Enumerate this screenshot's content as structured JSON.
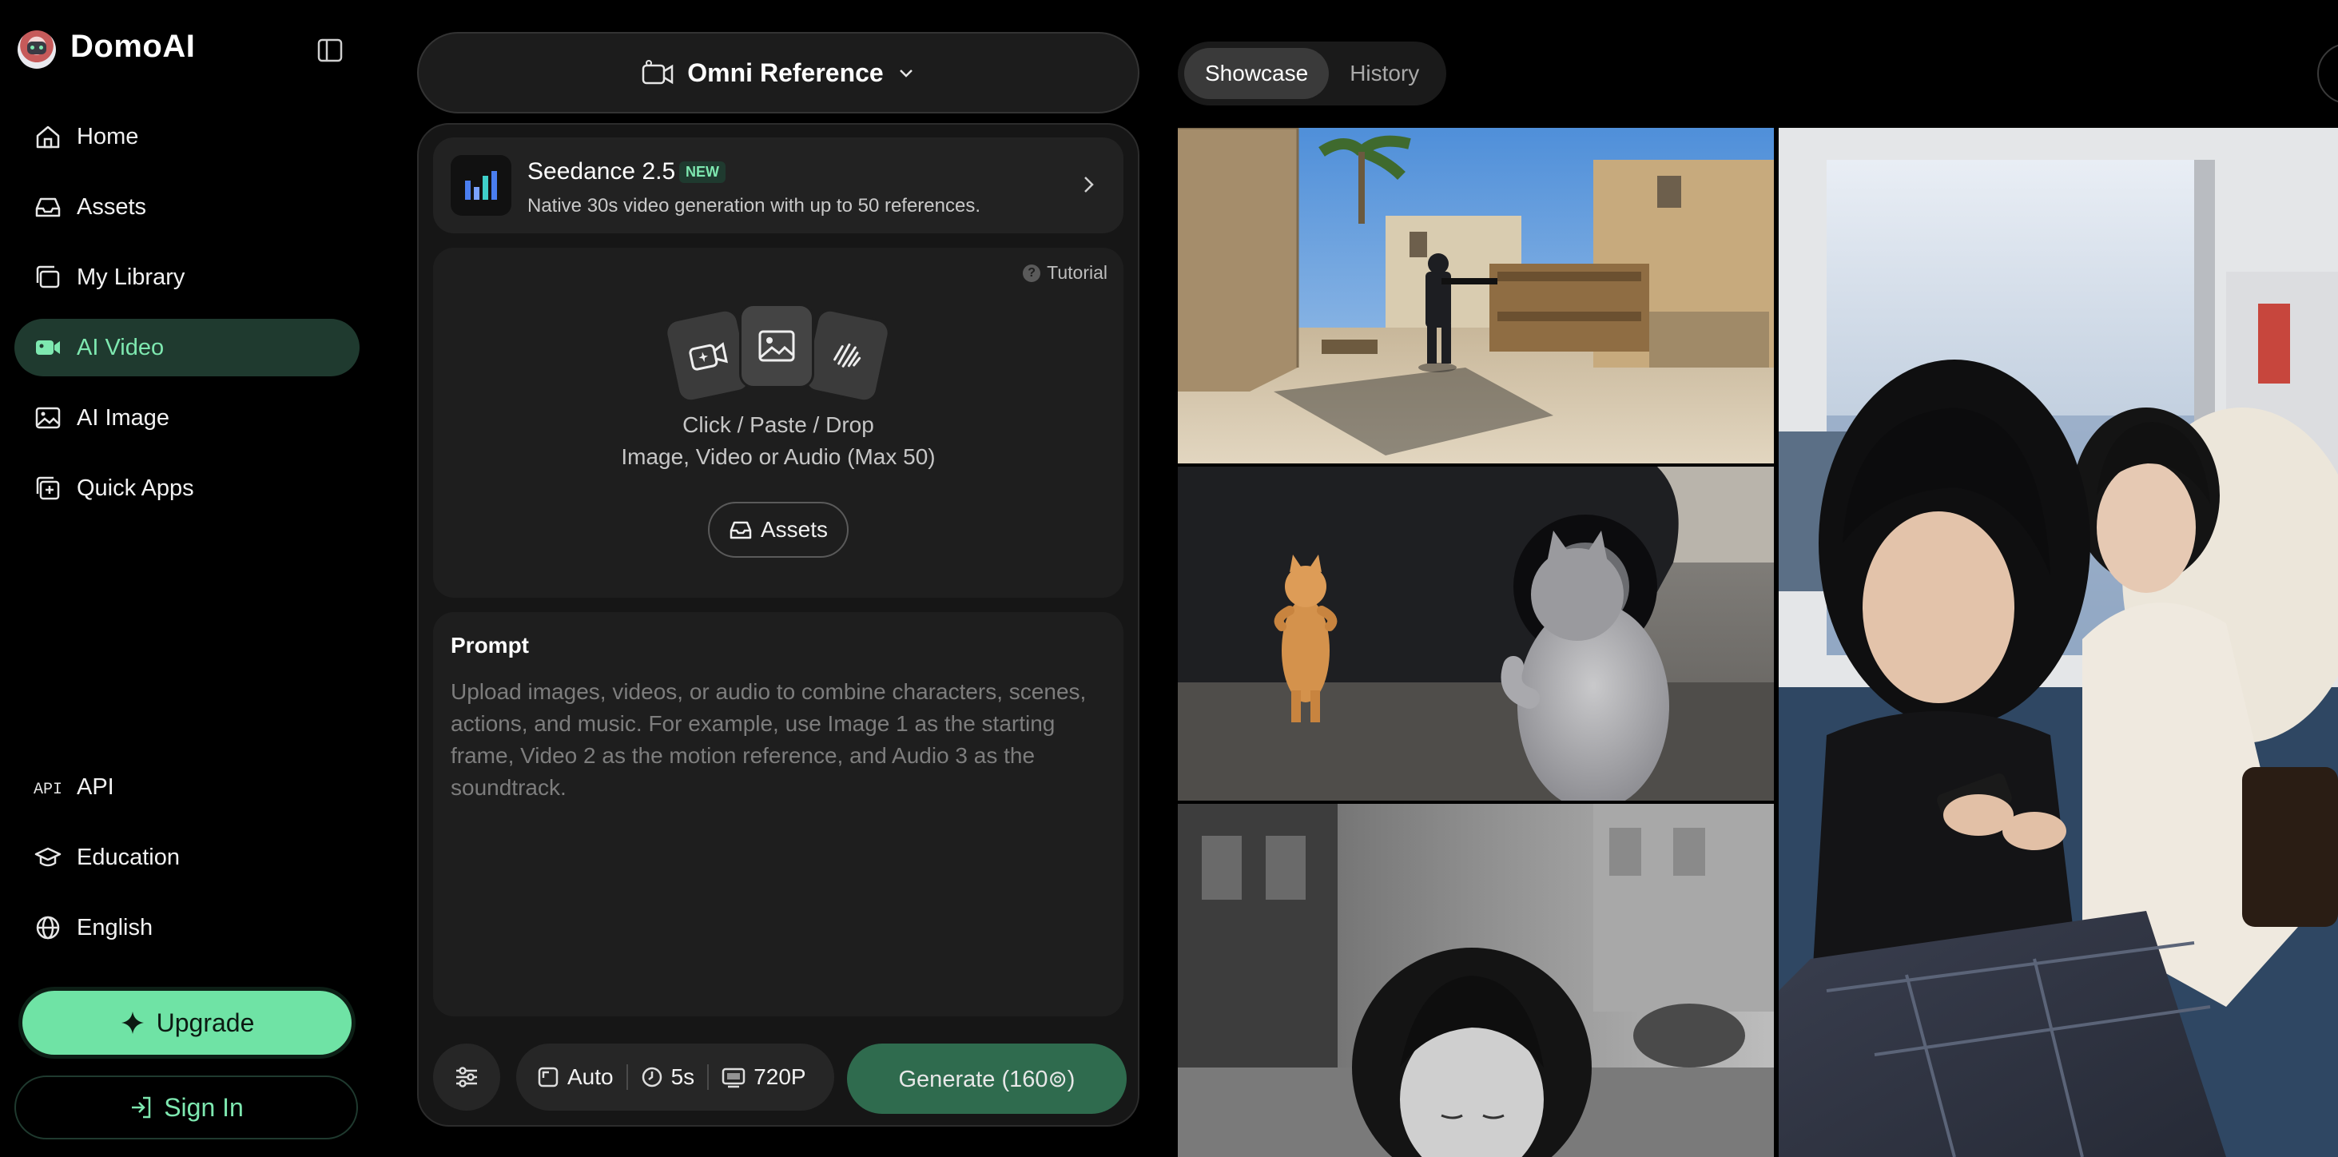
{
  "app": {
    "brand": "DomoAI"
  },
  "sidebar": {
    "items": [
      {
        "label": "Home",
        "icon": "home-icon"
      },
      {
        "label": "Assets",
        "icon": "inbox-icon"
      },
      {
        "label": "My Library",
        "icon": "library-icon"
      },
      {
        "label": "AI Video",
        "icon": "video-camera-icon",
        "active": true
      },
      {
        "label": "AI Image",
        "icon": "image-icon"
      },
      {
        "label": "Quick Apps",
        "icon": "apps-icon"
      }
    ],
    "footer_items": [
      {
        "label": "API",
        "icon": "api-icon"
      },
      {
        "label": "Education",
        "icon": "graduation-cap-icon"
      },
      {
        "label": "English",
        "icon": "globe-icon"
      }
    ],
    "upgrade_label": "Upgrade",
    "signin_label": "Sign In"
  },
  "mode": {
    "label": "Omni Reference"
  },
  "model": {
    "name": "Seedance 2.5",
    "badge": "NEW",
    "description": "Native 30s video generation with up to 50 references."
  },
  "upload": {
    "tutorial": "Tutorial",
    "line1": "Click / Paste / Drop",
    "line2": "Image, Video or Audio (Max 50)",
    "assets_button": "Assets"
  },
  "prompt": {
    "title": "Prompt",
    "placeholder": "Upload images, videos, or audio to combine characters, scenes, actions, and music. For example, use Image 1 as the starting frame, Video 2 as the motion reference, and Audio 3 as the soundtrack.",
    "value": ""
  },
  "options": {
    "ratio": "Auto",
    "duration": "5s",
    "resolution": "720P"
  },
  "generate": {
    "label": "Generate (160⊚)"
  },
  "tabs": {
    "showcase": "Showcase",
    "history": "History",
    "active": "Showcase"
  },
  "gallery": [
    {
      "name": "showcase-desert-soldier"
    },
    {
      "name": "showcase-cats-street"
    },
    {
      "name": "showcase-bw-woman"
    },
    {
      "name": "showcase-train-women"
    }
  ],
  "colors": {
    "accent": "#6fe3a5",
    "active_bg": "#1f3a2f",
    "generate_bg": "#2f6b4e"
  }
}
